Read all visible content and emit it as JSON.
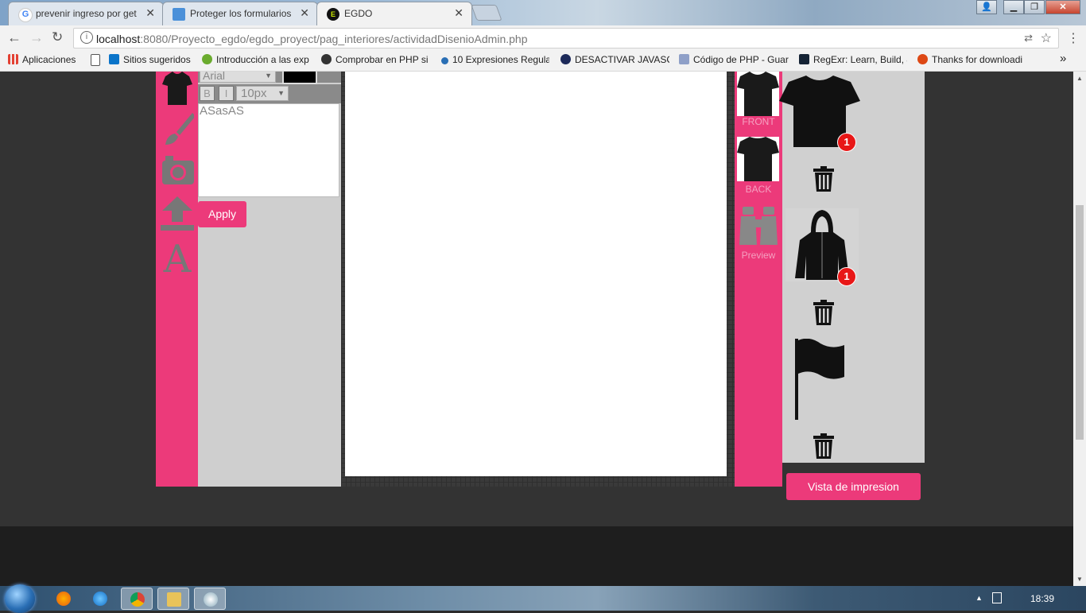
{
  "browser": {
    "tabs": [
      {
        "title": "prevenir ingreso por get",
        "close": "✕",
        "favicon": "google-icon"
      },
      {
        "title": "Proteger los formularios",
        "close": "✕",
        "favicon": "page-icon"
      },
      {
        "title": "EGDO",
        "close": "✕",
        "favicon": "egdo-icon"
      }
    ],
    "url_host": "localhost",
    "url_path": ":8080/Proyecto_egdo/egdo_proyect/pag_interiores/actividadDisenioAdmin.php",
    "bookmarks": [
      {
        "label": "Aplicaciones",
        "icon": "apps-grid-icon"
      },
      {
        "label": "Sitios sugeridos",
        "icon": "bing-icon"
      },
      {
        "label": "Introducción a las exp",
        "icon": "leaf-icon"
      },
      {
        "label": "Comprobar en PHP si",
        "icon": "check-icon"
      },
      {
        "label": "10 Expresiones Regula",
        "icon": "dot-icon"
      },
      {
        "label": "DESACTIVAR JAVASCR",
        "icon": "star-icon"
      },
      {
        "label": "Código de PHP - Guar",
        "icon": "braces-icon"
      },
      {
        "label": "RegExr: Learn, Build, &",
        "icon": "regexr-icon"
      },
      {
        "label": "Thanks for downloadi",
        "icon": "ubuntu-icon"
      }
    ],
    "more_bookmarks": "»"
  },
  "editor": {
    "font_family_value": "Arial",
    "bold_label": "B",
    "italic_label": "I",
    "font_size_value": "10px",
    "text_value": "ASasAS",
    "apply_label": "Apply",
    "text_color": "#000000",
    "accent_color": "#ec3a7a"
  },
  "views": {
    "front_label": "FRONT",
    "back_label": "BACK",
    "preview_label": "Preview"
  },
  "items": [
    {
      "name": "tshirt",
      "badge": "1"
    },
    {
      "name": "hoodie",
      "badge": "1"
    },
    {
      "name": "flag",
      "badge": ""
    }
  ],
  "print_preview_label": "Vista de impresion",
  "taskbar": {
    "clock": "18:39"
  }
}
